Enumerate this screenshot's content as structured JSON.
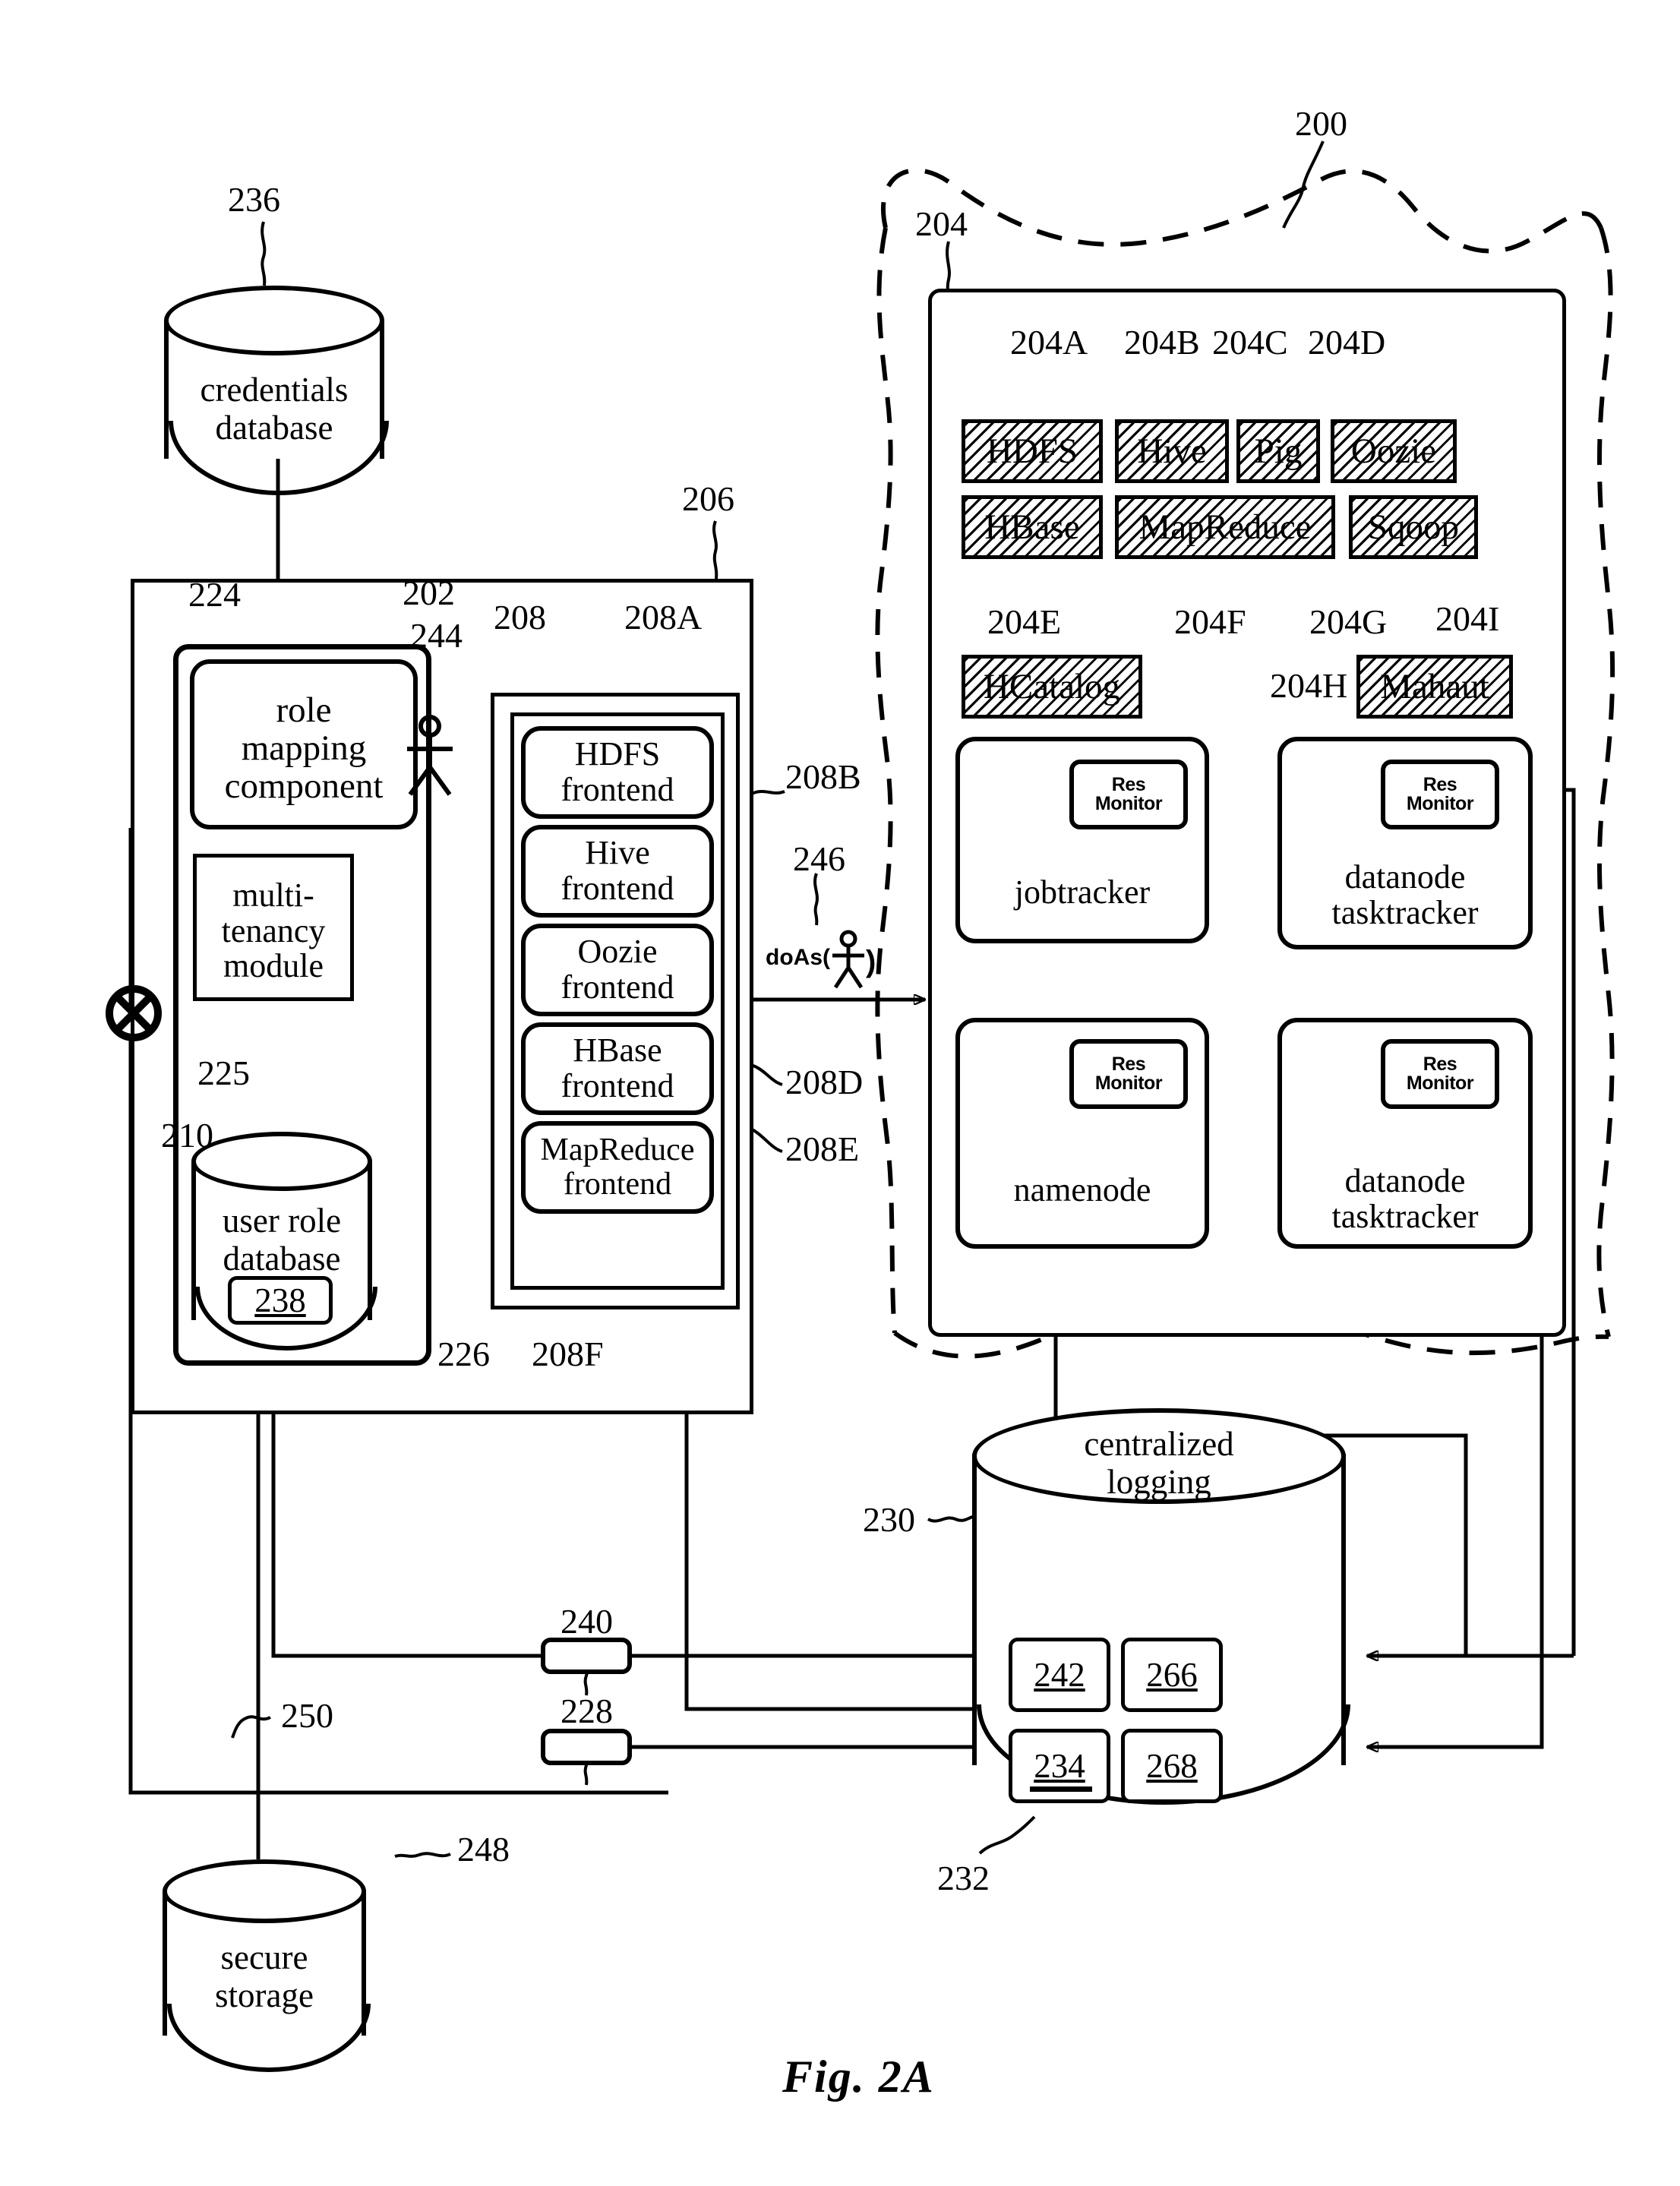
{
  "figure": {
    "caption": "Fig. 2A"
  },
  "refs": {
    "r200": "200",
    "r204": "204",
    "r204A": "204A",
    "r204B": "204B",
    "r204C": "204C",
    "r204D": "204D",
    "r204E": "204E",
    "r204F": "204F",
    "r204G": "204G",
    "r204H": "204H",
    "r204I": "204I",
    "r202": "202",
    "r206": "206",
    "r208": "208",
    "r208A": "208A",
    "r208B": "208B",
    "r208D": "208D",
    "r208E": "208E",
    "r208F": "208F",
    "r210": "210",
    "r224": "224",
    "r225": "225",
    "r226": "226",
    "r228": "228",
    "r230": "230",
    "r232": "232",
    "r236": "236",
    "r240": "240",
    "r244": "244",
    "r246": "246",
    "r248": "248",
    "r250": "250"
  },
  "cluster": {
    "services": [
      {
        "label": "HDFS",
        "ref": "204A"
      },
      {
        "label": "Hive",
        "ref": "204B"
      },
      {
        "label": "Pig",
        "ref": "204C"
      },
      {
        "label": "Oozie",
        "ref": "204D"
      },
      {
        "label": "HBase",
        "ref": "204E"
      },
      {
        "label": "MapReduce",
        "ref": "204F"
      },
      {
        "label": "Sqoop",
        "ref": "204G"
      },
      {
        "label": "HCatalog",
        "ref": "204H"
      },
      {
        "label": "Mahaut",
        "ref": "204I"
      }
    ],
    "nodes": [
      {
        "name": "jobtracker",
        "monitor": "Res Monitor"
      },
      {
        "name": "datanode tasktracker",
        "monitor": "Res Monitor"
      },
      {
        "name": "namenode",
        "monitor": "Res Monitor"
      },
      {
        "name": "datanode tasktracker",
        "monitor": "Res Monitor"
      }
    ],
    "monitor_line1": "Res",
    "monitor_line2": "Monitor",
    "node_jobtracker": "jobtracker",
    "node_namenode": "namenode",
    "node_datanode_1_line1": "datanode",
    "node_datanode_1_line2": "tasktracker",
    "node_datanode_2_line1": "datanode",
    "node_datanode_2_line2": "tasktracker"
  },
  "gateway": {
    "role_mapping": {
      "line1": "role",
      "line2": "mapping",
      "line3": "component"
    },
    "multi_tenancy": {
      "line1": "multi-",
      "line2": "tenancy",
      "line3": "module"
    },
    "user_role_db": {
      "line1": "user role",
      "line2": "database",
      "inner_ref": "238"
    },
    "frontends": [
      {
        "line1": "HDFS",
        "line2": "frontend"
      },
      {
        "line1": "Hive",
        "line2": "frontend"
      },
      {
        "line1": "Oozie",
        "line2": "frontend"
      },
      {
        "line1": "HBase",
        "line2": "frontend"
      },
      {
        "line1": "MapReduce",
        "line2": "frontend"
      }
    ],
    "doas_label": "doAs(",
    "doas_close": ")"
  },
  "stores": {
    "credentials": {
      "line1": "credentials",
      "line2": "database"
    },
    "secure": {
      "line1": "secure",
      "line2": "storage"
    },
    "logging": {
      "line1": "centralized",
      "line2": "logging",
      "cells": [
        "242",
        "266",
        "234",
        "268"
      ]
    }
  }
}
